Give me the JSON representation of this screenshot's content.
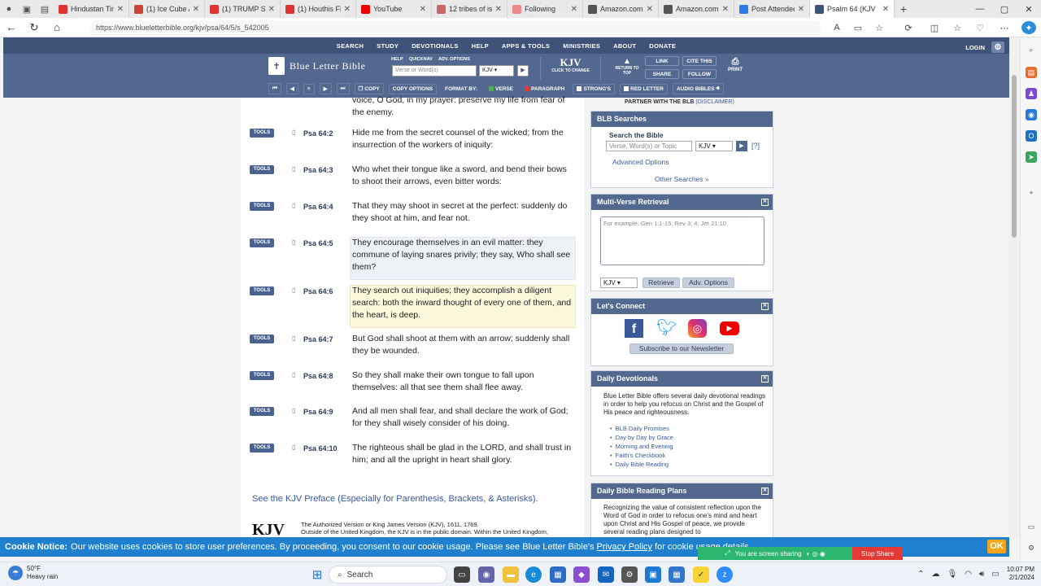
{
  "browser": {
    "tabs": [
      {
        "label": "Hindustan Tim",
        "color": "#d33"
      },
      {
        "label": "(1) Ice Cube A",
        "color": "#c43"
      },
      {
        "label": "(1) TRUMP SA",
        "color": "#d33"
      },
      {
        "label": "(1) Houthis Fir",
        "color": "#d33"
      },
      {
        "label": "YouTube",
        "color": "#e00"
      },
      {
        "label": "12 tribes of isr",
        "color": "#c66"
      },
      {
        "label": "Following",
        "color": "#e88"
      },
      {
        "label": "Amazon.com:",
        "color": "#555"
      },
      {
        "label": "Amazon.com:",
        "color": "#555"
      },
      {
        "label": "Post Attendee",
        "color": "#2d7be5"
      },
      {
        "label": "Psalm 64 (KJV",
        "color": "#3f5378"
      }
    ],
    "new_tab": "+",
    "url": "https://www.blueletterbible.org/kjv/psa/64/5/s_542005"
  },
  "header": {
    "topnav": [
      "SEARCH",
      "STUDY",
      "DEVOTIONALS",
      "HELP",
      "APPS & TOOLS",
      "MINISTRIES",
      "ABOUT",
      "DONATE"
    ],
    "login": "LOGIN",
    "logo": "Blue Letter Bible",
    "help": "HELP",
    "quicknav": "QUICKNAV",
    "adv_options": "ADV. OPTIONS",
    "search_placeholder": "Verse or Word(s)",
    "version": "KJV",
    "kjv_big": "KJV",
    "kjv_small": "CLICK TO CHANGE",
    "return_top": "RETURN TO TOP",
    "link": "LINK",
    "cite": "CITE THIS",
    "share": "SHARE",
    "follow": "FOLLOW",
    "print": "PRINT",
    "copy": "COPY",
    "copy_options": "COPY OPTIONS",
    "format_by": "FORMAT BY:",
    "verse": "VERSE",
    "paragraph": "PARAGRAPH",
    "strongs": "STRONG'S",
    "red_letter": "RED LETTER",
    "audio": "AUDIO BIBLES"
  },
  "main": {
    "prev_text": "voice, O God, in my prayer: preserve my life from fear of the enemy.",
    "tools_label": "TOOLS",
    "verses": [
      {
        "ref": "Psa 64:2",
        "text": "Hide me from the secret counsel of the wicked; from the insurrection of the workers of iniquity:"
      },
      {
        "ref": "Psa 64:3",
        "text": "Who whet their tongue like a sword, and bend their bows to shoot their arrows, even bitter words:"
      },
      {
        "ref": "Psa 64:4",
        "text": "That they may shoot in secret at the perfect: suddenly do they shoot at him, and fear not."
      },
      {
        "ref": "Psa 64:5",
        "text": "They encourage themselves in an evil matter: they commune of laying snares privily; they say, Who shall see them?"
      },
      {
        "ref": "Psa 64:6",
        "text": "They search out iniquities; they accomplish a diligent search: both the inward thought of every one of them, and the heart, is deep."
      },
      {
        "ref": "Psa 64:7",
        "text": "But God shall shoot at them with an arrow; suddenly shall they be wounded."
      },
      {
        "ref": "Psa 64:8",
        "text": "So they shall make their own tongue to fall upon themselves: all that see them shall flee away."
      },
      {
        "ref": "Psa 64:9",
        "text": "And all men shall fear, and shall declare the work of God; for they shall wisely consider of his doing."
      },
      {
        "ref": "Psa 64:10",
        "text": "The righteous shall be glad in the LORD, and shall trust in him; and all the upright in heart shall glory."
      }
    ],
    "preface": "See the KJV Preface (Especially for Parenthesis, Brackets, & Asterisks).",
    "kjv_logo": "KJV",
    "auth_line1": "The Authorized Version or King James Version (KJV), 1611, 1769.",
    "auth_line2": "Outside of the United Kingdom, the KJV is in the public domain. Within the United Kingdom,"
  },
  "side": {
    "partner": "PARTNER WITH THE BLB",
    "disclaimer": "(DISCLAIMER)",
    "searches_title": "BLB Searches",
    "search_bible": "Search the Bible",
    "search_placeholder": "Verse, Word(s) or Topic",
    "version": "KJV",
    "help_q": "[?]",
    "advanced": "Advanced Options",
    "other": "Other Searches »",
    "mvr_title": "Multi-Verse Retrieval",
    "mvr_placeholder": "For example: Gen 1:1-15; Rev 3; 4; Jer 21:10",
    "retrieve": "Retrieve",
    "adv_options": "Adv. Options",
    "connect_title": "Let's Connect",
    "newsletter": "Subscribe to our Newsletter",
    "devo_title": "Daily Devotionals",
    "devo_text": "Blue Letter Bible offers several daily devotional readings in order to help you refocus on Christ and the Gospel of His peace and righteousness.",
    "devo_items": [
      "BLB Daily Promises",
      "Day by Day by Grace",
      "Morning and Evening",
      "Faith's Checkbook",
      "Daily Bible Reading"
    ],
    "plans_title": "Daily Bible Reading Plans",
    "plans_text": "Recognizing the value of consistent reflection upon the Word of God in order to refocus one's mind and heart upon Christ and His Gospel of peace, we provide several reading plans designed to"
  },
  "cookie": {
    "title": "Cookie Notice:",
    "text": "Our website uses cookies to store user preferences. By proceeding, you consent to our cookie usage. Please see Blue Letter Bible's",
    "link": "Privacy Policy",
    "tail": "for cookie usage details.",
    "ok": "OK"
  },
  "screenshare": {
    "text": "You are screen sharing",
    "stop": "Stop Share"
  },
  "taskbar": {
    "temp": "50°F",
    "weather": "Heavy rain",
    "search": "Search",
    "time": "10:07 PM",
    "date": "2/1/2024"
  }
}
